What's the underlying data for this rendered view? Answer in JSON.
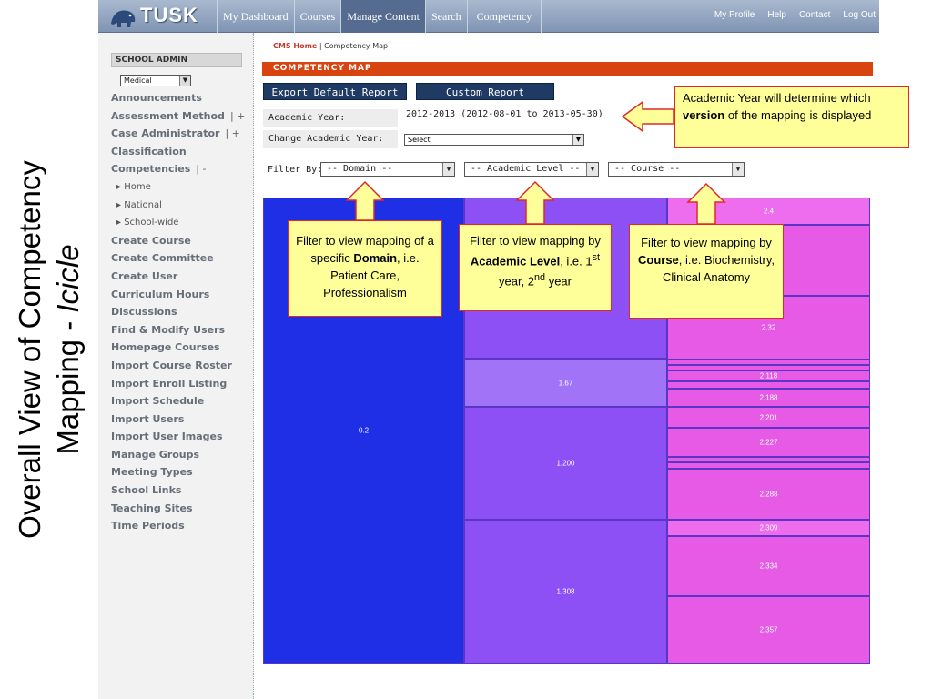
{
  "slide": {
    "title_line1": "Overall View of Competency",
    "title_line2_prefix": "Mapping - ",
    "title_line2_italic": "Icicle"
  },
  "nav": {
    "logo": "TUSK",
    "tabs": [
      "My Dashboard",
      "Courses",
      "Manage Content",
      "Search",
      "Competency"
    ],
    "active_tab": "Manage Content",
    "right_links": [
      "My Profile",
      "Help",
      "Contact",
      "Log Out"
    ]
  },
  "sidebar": {
    "header": "SCHOOL ADMIN",
    "school": "Medical",
    "items": [
      {
        "label": "Announcements",
        "extra": ""
      },
      {
        "label": "Assessment Method",
        "extra": "| +"
      },
      {
        "label": "Case Administrator",
        "extra": "| +"
      },
      {
        "label": "Classification",
        "extra": ""
      },
      {
        "label": "Competencies",
        "extra": "| -"
      },
      {
        "label": "▸ Home",
        "extra": "",
        "sub": true
      },
      {
        "label": "▸ National",
        "extra": "",
        "sub": true
      },
      {
        "label": "▸ School-wide",
        "extra": "",
        "sub": true
      },
      {
        "label": "Create Course",
        "extra": ""
      },
      {
        "label": "Create Committee",
        "extra": ""
      },
      {
        "label": "Create User",
        "extra": ""
      },
      {
        "label": "Curriculum Hours",
        "extra": ""
      },
      {
        "label": "Discussions",
        "extra": ""
      },
      {
        "label": "Find & Modify Users",
        "extra": ""
      },
      {
        "label": "Homepage Courses",
        "extra": ""
      },
      {
        "label": "Import Course Roster",
        "extra": ""
      },
      {
        "label": "Import Enroll Listing",
        "extra": ""
      },
      {
        "label": "Import Schedule",
        "extra": ""
      },
      {
        "label": "Import Users",
        "extra": ""
      },
      {
        "label": "Import User Images",
        "extra": ""
      },
      {
        "label": "Manage Groups",
        "extra": ""
      },
      {
        "label": "Meeting Types",
        "extra": ""
      },
      {
        "label": "School Links",
        "extra": ""
      },
      {
        "label": "Teaching Sites",
        "extra": ""
      },
      {
        "label": "Time Periods",
        "extra": ""
      }
    ]
  },
  "main": {
    "breadcrumb_home": "CMS Home",
    "breadcrumb_sep": " | ",
    "breadcrumb_current": "Competency Map",
    "section_title": "COMPETENCY MAP",
    "export_button": "Export Default Report",
    "custom_button": "Custom Report",
    "academic_year_label": "Academic Year:",
    "academic_year_value": "2012-2013 (2012-08-01 to 2013-05-30)",
    "change_year_label": "Change Academic Year:",
    "change_year_selected": "Select",
    "filter_label": "Filter By:",
    "filter_domain": "-- Domain --",
    "filter_level": "-- Academic Level --",
    "filter_course": "-- Course --"
  },
  "icicle": {
    "colors": {
      "level1": "#1e2fe6",
      "level2": "#8c50f5",
      "level3": "#e65ae6"
    },
    "level1": [
      {
        "label": "0.2"
      }
    ],
    "level2": [
      {
        "label": ""
      },
      {
        "label": "1.67"
      },
      {
        "label": "1.200"
      },
      {
        "label": "1.308"
      }
    ],
    "level3": [
      {
        "label": "2.4"
      },
      {
        "label": ""
      },
      {
        "label": "2.32"
      },
      {
        "label": ""
      },
      {
        "label": ""
      },
      {
        "label": "2.118"
      },
      {
        "label": ""
      },
      {
        "label": "2.188"
      },
      {
        "label": "2.201"
      },
      {
        "label": "2.227"
      },
      {
        "label": ""
      },
      {
        "label": ""
      },
      {
        "label": "2.288"
      },
      {
        "label": "2.309"
      },
      {
        "label": "2.334"
      },
      {
        "label": "2.357"
      }
    ]
  },
  "callouts": {
    "academic_year_note_1": "Academic Year will determine which ",
    "academic_year_note_bold": "version",
    "academic_year_note_2": " of the mapping is displayed",
    "domain_1": "Filter to view mapping of a specific ",
    "domain_bold": "Domain",
    "domain_2": ", i.e. Patient Care, Professionalism",
    "level_1": "Filter to view mapping by ",
    "level_bold": "Academic Level",
    "level_2": ", i.e. 1",
    "level_sup1": "st",
    "level_3": " year, 2",
    "level_sup2": "nd",
    "level_4": " year",
    "course_1": "Filter to view mapping by ",
    "course_bold": "Course",
    "course_2": ", i.e. Biochemistry, Clinical Anatomy"
  }
}
